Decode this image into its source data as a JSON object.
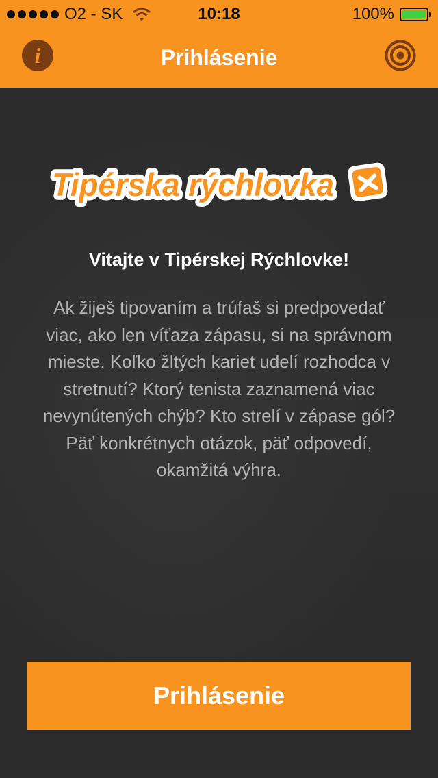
{
  "status_bar": {
    "carrier": "O2 - SK",
    "time": "10:18",
    "battery": "100%",
    "battery_level": 1.0,
    "signal_icon": "signal-dots-icon",
    "wifi_icon": "wifi-icon",
    "battery_icon": "battery-icon"
  },
  "nav": {
    "title": "Prihlásenie",
    "info_glyph": "i",
    "left_icon": "info-icon",
    "right_icon": "target-icon"
  },
  "logo": {
    "text": "Tipérska rýchlovka"
  },
  "content": {
    "welcome": "Vitajte v Tipérskej Rýchlovke!",
    "description": "Ak žiješ tipovaním a trúfaš si predpovedať viac, ako len víťaza zápasu, si na správnom mieste. Koľko žltých kariet udelí rozhodca v stretnutí? Ktorý tenista zaznamená viac nevynútených chýb? Kto strelí v zápase gól? Päť konkrétnych otázok, päť odpovedí, okamžitá výhra."
  },
  "login_button": {
    "label": "Prihlásenie"
  },
  "colors": {
    "accent": "#f7931e",
    "background": "#2b2b2b",
    "icon_brown": "#7a3d12",
    "battery_green": "#3fd13f"
  }
}
